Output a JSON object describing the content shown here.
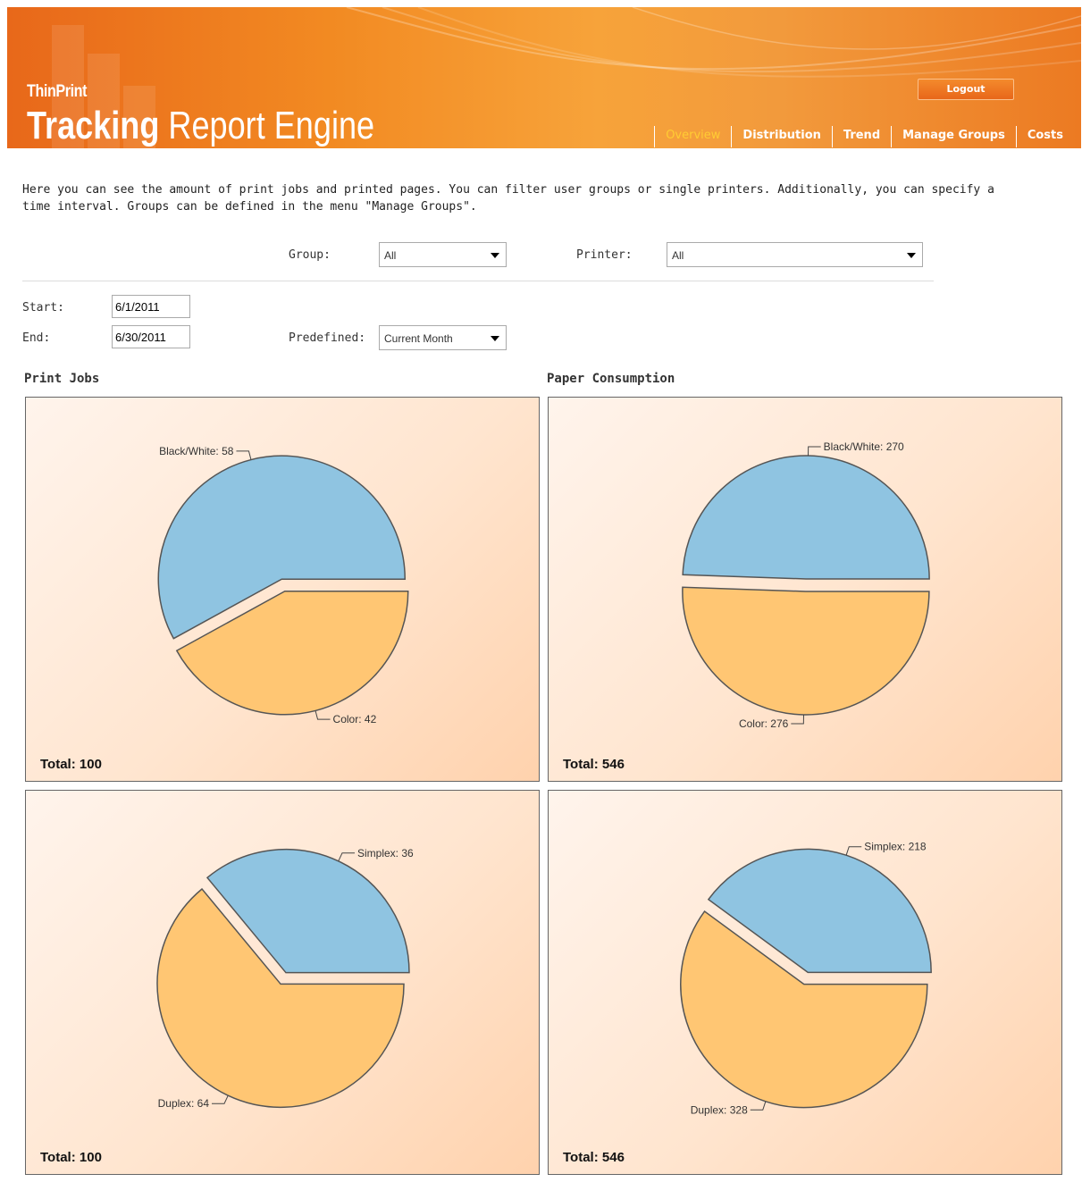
{
  "brand": {
    "small": "ThinPrint",
    "bold": "Tracking",
    "rest": "Report Engine"
  },
  "header": {
    "logout_label": "Logout"
  },
  "nav": {
    "tabs": [
      {
        "label": "Overview",
        "active": true
      },
      {
        "label": "Distribution"
      },
      {
        "label": "Trend"
      },
      {
        "label": "Manage Groups"
      },
      {
        "label": "Costs"
      }
    ]
  },
  "intro_text": "Here you can see the amount of print jobs and printed pages. You can filter user groups or single printers. Additionally, you can specify a time interval. Groups can be defined in the menu \"Manage Groups\".",
  "filters": {
    "group_label": "Group:",
    "group_value": "All",
    "printer_label": "Printer:",
    "printer_value": "All",
    "start_label": "Start:",
    "start_value": "6/1/2011",
    "end_label": "End:",
    "end_value": "6/30/2011",
    "predefined_label": "Predefined:",
    "predefined_value": "Current Month"
  },
  "sections": {
    "print_jobs": "Print Jobs",
    "paper_consumption": "Paper Consumption"
  },
  "colors": {
    "blue": "#8fc4e1",
    "orange": "#ffc673"
  },
  "chart_data": [
    {
      "type": "pie",
      "id": "jobs-color",
      "slices": [
        {
          "label": "Black/White",
          "value": 58,
          "color": "#8fc4e1"
        },
        {
          "label": "Color",
          "value": 42,
          "color": "#ffc673"
        }
      ],
      "total_label": "Total: 100"
    },
    {
      "type": "pie",
      "id": "pages-color",
      "slices": [
        {
          "label": "Black/White",
          "value": 270,
          "color": "#8fc4e1"
        },
        {
          "label": "Color",
          "value": 276,
          "color": "#ffc673"
        }
      ],
      "total_label": "Total: 546"
    },
    {
      "type": "pie",
      "id": "jobs-duplex",
      "slices": [
        {
          "label": "Simplex",
          "value": 36,
          "color": "#8fc4e1"
        },
        {
          "label": "Duplex",
          "value": 64,
          "color": "#ffc673"
        }
      ],
      "total_label": "Total: 100"
    },
    {
      "type": "pie",
      "id": "pages-duplex",
      "slices": [
        {
          "label": "Simplex",
          "value": 218,
          "color": "#8fc4e1"
        },
        {
          "label": "Duplex",
          "value": 328,
          "color": "#ffc673"
        }
      ],
      "total_label": "Total: 546"
    }
  ]
}
